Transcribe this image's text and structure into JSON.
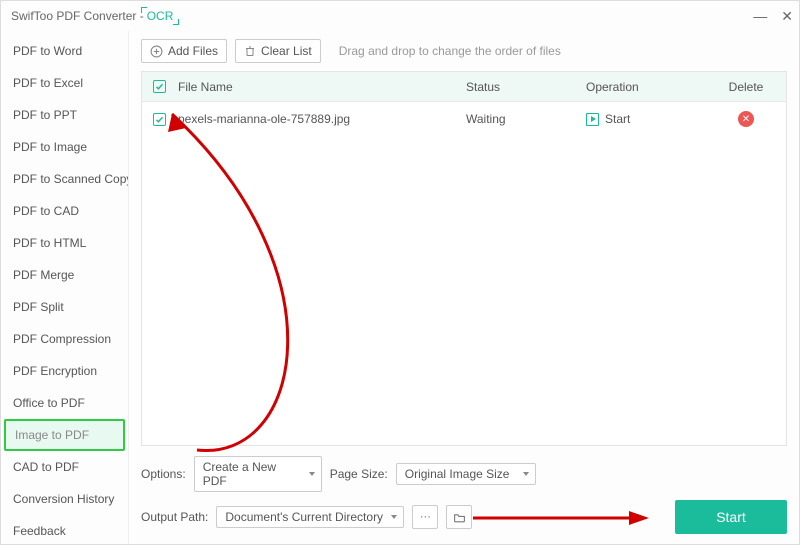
{
  "title_prefix": "SwifToo PDF Converter - ",
  "title_badge": "OCR",
  "sidebar": {
    "items": [
      {
        "label": "PDF to Word"
      },
      {
        "label": "PDF to Excel"
      },
      {
        "label": "PDF to PPT"
      },
      {
        "label": "PDF to Image"
      },
      {
        "label": "PDF to Scanned Copy"
      },
      {
        "label": "PDF to CAD"
      },
      {
        "label": "PDF to HTML"
      },
      {
        "label": "PDF Merge"
      },
      {
        "label": "PDF Split"
      },
      {
        "label": "PDF Compression"
      },
      {
        "label": "PDF Encryption"
      },
      {
        "label": "Office to PDF"
      },
      {
        "label": "Image to PDF"
      },
      {
        "label": "CAD to PDF"
      },
      {
        "label": "Conversion History"
      },
      {
        "label": "Feedback"
      }
    ],
    "active_index": 12
  },
  "toolbar": {
    "add_files": "Add Files",
    "clear_list": "Clear List",
    "hint": "Drag and drop to change the order of files"
  },
  "columns": {
    "name": "File Name",
    "status": "Status",
    "operation": "Operation",
    "delete": "Delete"
  },
  "files": [
    {
      "name": "pexels-marianna-ole-757889.jpg",
      "status": "Waiting",
      "op": "Start",
      "checked": true
    }
  ],
  "header_checked": true,
  "options": {
    "label": "Options:",
    "create": "Create a New PDF",
    "pagesize_label": "Page Size:",
    "pagesize": "Original Image Size"
  },
  "output": {
    "label": "Output Path:",
    "value": "Document's Current Directory",
    "dots": "···"
  },
  "start_button": "Start"
}
